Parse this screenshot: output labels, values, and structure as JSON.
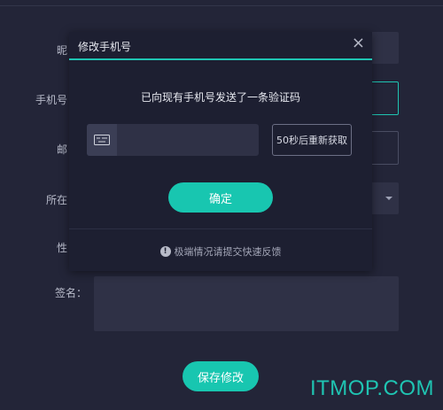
{
  "form": {
    "nickname_label": "昵",
    "phone_label": "手机号",
    "email_label": "邮",
    "location_label": "所在",
    "gender_label": "性",
    "signature_label": "签名：",
    "save_label": "保存修改"
  },
  "modal": {
    "title": "修改手机号",
    "close_icon": "×",
    "message": "已向现有手机号发送了一条验证码",
    "code_placeholder": "",
    "resend_label": "50秒后重新获取",
    "confirm_label": "确定",
    "feedback_icon": "!",
    "feedback_text": "极端情况请提交快速反馈"
  },
  "watermark": "ITMOP.COM",
  "colors": {
    "accent": "#18c6b0",
    "background": "#232538",
    "modal_bg": "#1d1f31"
  }
}
